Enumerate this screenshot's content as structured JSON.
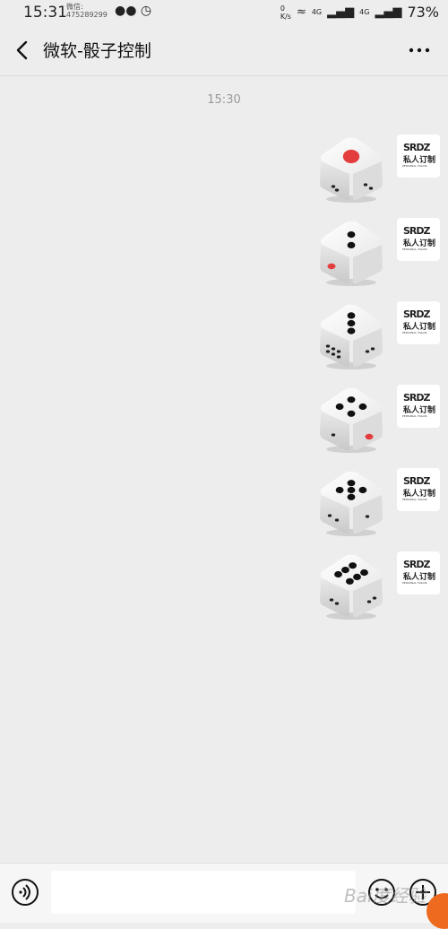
{
  "status_bar": {
    "time": "15:31",
    "wechat_label": "微信:",
    "wechat_id": "475289299",
    "network_speed_value": "0",
    "network_speed_unit": "K/s",
    "signal_1": "4G",
    "signal_2": "4G",
    "battery": "73%"
  },
  "header": {
    "title": "微软-骰子控制"
  },
  "chat": {
    "timestamp": "15:30",
    "messages": [
      {
        "type": "dice",
        "value": 1
      },
      {
        "type": "dice",
        "value": 2
      },
      {
        "type": "dice",
        "value": 3
      },
      {
        "type": "dice",
        "value": 4
      },
      {
        "type": "dice",
        "value": 5
      },
      {
        "type": "dice",
        "value": 6
      }
    ],
    "avatar": {
      "logo_top": "SRDZ",
      "logo_mid": "私人订制",
      "logo_bot": "PERSONAL TAILOR"
    }
  },
  "watermark": {
    "text": "Bai度经验"
  },
  "icons": {
    "back": "chevron-left-icon",
    "more": "more-dots-icon",
    "voice": "voice-icon",
    "emoji": "emoji-icon",
    "plus": "plus-icon"
  },
  "colors": {
    "background": "#ededed",
    "pip_red": "#e43d3d",
    "pip_black": "#111111"
  }
}
